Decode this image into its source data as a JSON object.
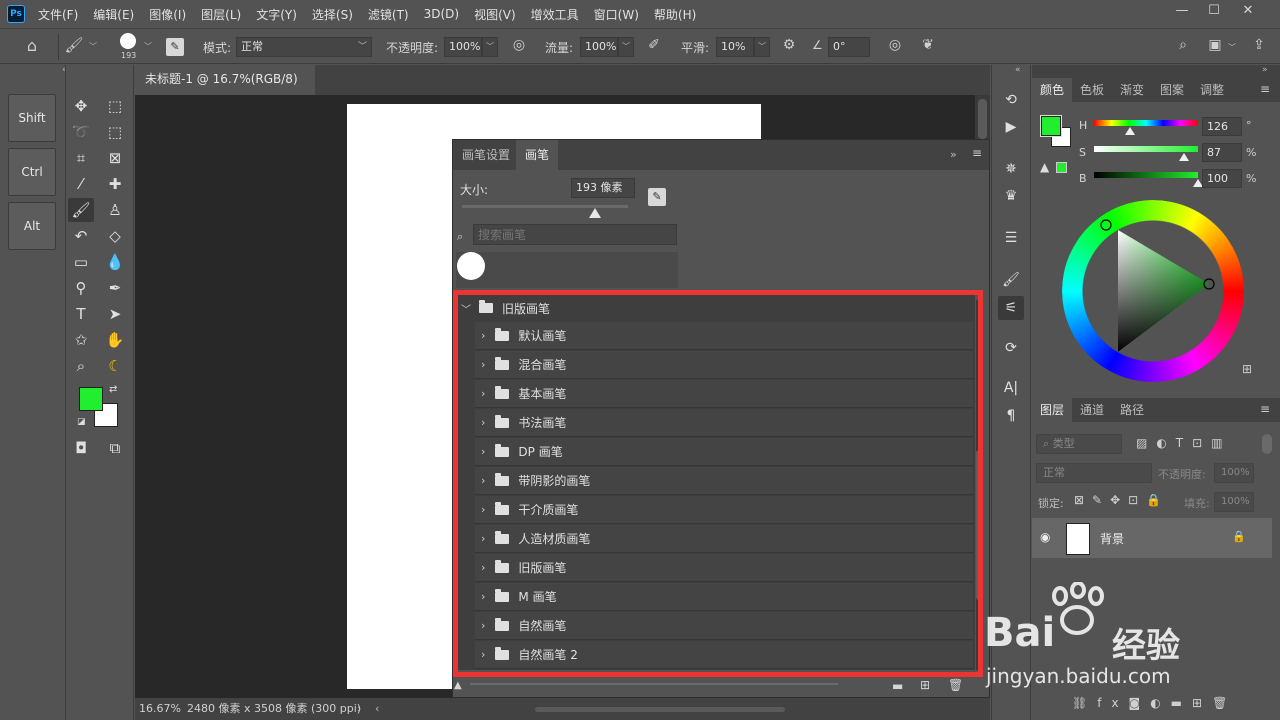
{
  "app": {
    "logo": "Ps",
    "menu": [
      "文件(F)",
      "编辑(E)",
      "图像(I)",
      "图层(L)",
      "文字(Y)",
      "选择(S)",
      "滤镜(T)",
      "3D(D)",
      "视图(V)",
      "增效工具",
      "窗口(W)",
      "帮助(H)"
    ]
  },
  "options": {
    "brush_size_label": "193",
    "mode_label": "模式:",
    "mode_value": "正常",
    "opacity_label": "不透明度:",
    "opacity_value": "100%",
    "flow_label": "流量:",
    "flow_value": "100%",
    "smooth_label": "平滑:",
    "smooth_value": "10%",
    "angle_value": "0°"
  },
  "modifiers": [
    "Shift",
    "Ctrl",
    "Alt"
  ],
  "document": {
    "tab_title": "未标题-1 @ 16.7%(RGB/8) *",
    "zoom": "16.67%",
    "doc_info": "2480 像素 x 3508 像素 (300 ppi)"
  },
  "brush_panel": {
    "tabs": [
      "画笔设置",
      "画笔"
    ],
    "size_label": "大小:",
    "size_value": "193 像素",
    "size_fraction": 0.8,
    "search_placeholder": "搜索画笔",
    "root_folder": "旧版画笔",
    "folders": [
      "默认画笔",
      "混合画笔",
      "基本画笔",
      "书法画笔",
      "DP 画笔",
      "带阴影的画笔",
      "干介质画笔",
      "人造材质画笔",
      "旧版画笔",
      "M 画笔",
      "自然画笔",
      "自然画笔 2"
    ]
  },
  "color_panel": {
    "tabs": [
      "颜色",
      "色板",
      "渐变",
      "图案",
      "调整"
    ],
    "h_label": "H",
    "h_value": "126",
    "h_unit": "°",
    "s_label": "S",
    "s_value": "87",
    "s_unit": "%",
    "b_label": "B",
    "b_value": "100",
    "b_unit": "%",
    "fg_color": "#21ee2f",
    "bg_color": "#ffffff"
  },
  "layers_panel": {
    "tabs": [
      "图层",
      "通道",
      "路径"
    ],
    "filter_label": "类型",
    "blend_mode": "正常",
    "opacity_label": "不透明度:",
    "opacity_value": "100%",
    "lock_label": "锁定:",
    "fill_label": "填充:",
    "fill_value": "100%",
    "layer_name": "背景"
  },
  "watermark": {
    "brand": "Bai",
    "brand_suffix": "经验",
    "url": "jingyan.baidu.com"
  }
}
